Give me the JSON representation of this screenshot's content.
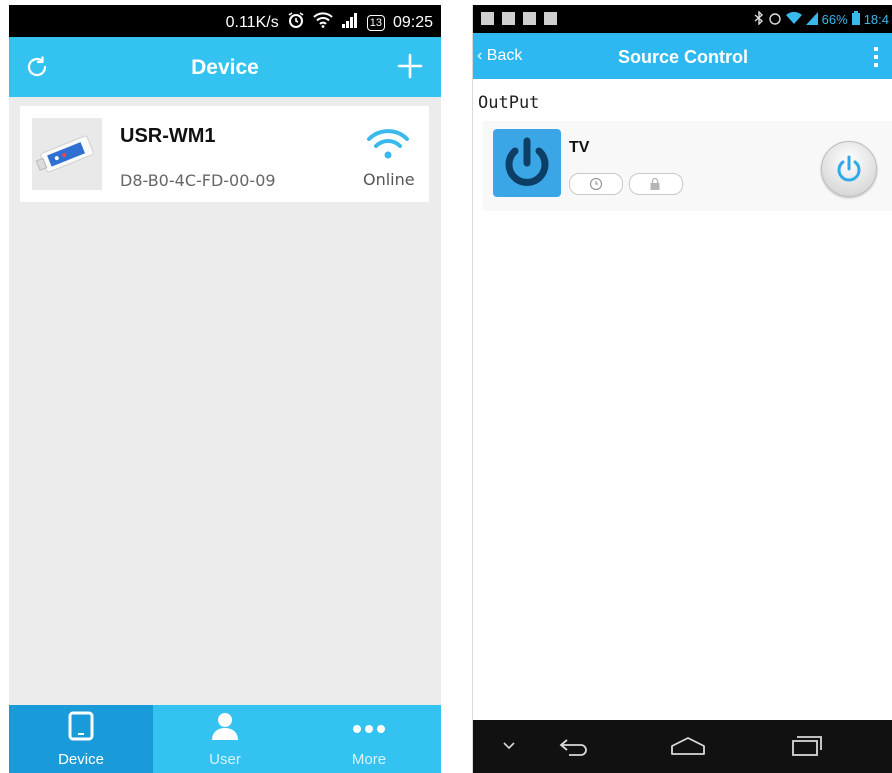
{
  "left_screen": {
    "status_bar": {
      "speed": "0.11K/s",
      "alarm_icon": "alarm-icon",
      "wifi_icon": "wifi-icon",
      "signal_icon": "signal-bars-icon",
      "battery_level": "13",
      "time": "09:25"
    },
    "title_bar": {
      "title": "Device",
      "refresh_icon": "refresh-icon",
      "add_icon": "plus-icon"
    },
    "devices": [
      {
        "name": "USR-WM1",
        "mac": "D8-B0-4C-FD-00-09",
        "status": "Online",
        "status_icon": "wifi-icon"
      }
    ],
    "tab_bar": {
      "tabs": [
        {
          "label": "Device",
          "icon": "tablet-icon",
          "active": true
        },
        {
          "label": "User",
          "icon": "person-icon",
          "active": false
        },
        {
          "label": "More",
          "icon": "more-dots-icon",
          "active": false
        }
      ]
    }
  },
  "right_screen": {
    "status_bar": {
      "battery_percent": "66%",
      "time": "18:4"
    },
    "title_bar": {
      "back_label": "Back",
      "title": "Source Control",
      "menu_icon": "overflow-menu-icon"
    },
    "section_label": "OutPut",
    "outputs": [
      {
        "name": "TV",
        "tile_icon": "power-icon",
        "timer_icon": "clock-icon",
        "lock_icon": "lock-icon",
        "toggle_icon": "power-icon"
      }
    ],
    "nav_bar": {
      "buttons": [
        "chevron-down-icon",
        "back-arrow-icon",
        "home-icon",
        "recent-apps-icon"
      ]
    }
  },
  "colors": {
    "left_accent": "#34c3f0",
    "left_tab_active": "#1a9bd9",
    "right_accent": "#2db8f1",
    "power_tile": "#3ba6e6",
    "power_glyph": "#2fa9e8"
  }
}
